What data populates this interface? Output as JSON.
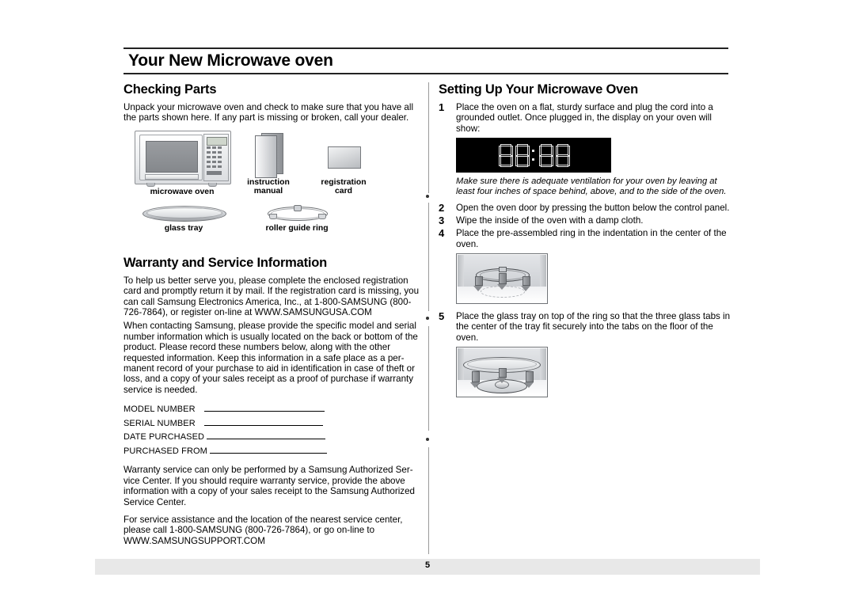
{
  "document": {
    "title": "Your New Microwave oven",
    "page_number": "5"
  },
  "left_column": {
    "checking_parts": {
      "heading": "Checking Parts",
      "intro": "Unpack your microwave oven and check to make sure that you have all the parts shown here. If any part is missing or broken, call your dealer.",
      "parts": [
        {
          "id": "microwave-oven",
          "label": "microwave oven"
        },
        {
          "id": "instruction-manual",
          "label": "instruction\nmanual"
        },
        {
          "id": "registration-card",
          "label": "registration\ncard"
        },
        {
          "id": "glass-tray",
          "label": "glass tray"
        },
        {
          "id": "roller-guide-ring",
          "label": "roller guide ring"
        }
      ]
    },
    "warranty": {
      "heading": "Warranty and Service Information",
      "paragraph1": "To help us better serve you, please complete the enclosed registration card and promptly return it by mail.  If the registration card is missing, you can call Samsung Electronics America, Inc., at 1-800-SAMSUNG (800-726-7864), or register on-line at WWW.SAMSUNGUSA.COM",
      "paragraph2": "When contacting Samsung, please provide the specific model and serial number information which is usually located on the back or bottom of the product.  Please record these numbers below, along with the other requested information.  Keep this information in a safe place as a per-manent record of your purchase to aid in identification in case of theft or loss, and a copy of your sales receipt as a proof of purchase if warranty service is needed.",
      "fields": [
        {
          "label": "MODEL NUMBER",
          "value": "",
          "line_width": 152,
          "gap": 8
        },
        {
          "label": "SERIAL NUMBER",
          "value": "",
          "line_width": 150,
          "gap": 8
        },
        {
          "label": "DATE PURCHASED",
          "value": "",
          "line_width": 150,
          "gap": 0
        },
        {
          "label": "PURCHASED FROM",
          "value": "",
          "line_width": 148,
          "gap": 0
        }
      ],
      "paragraph3": "Warranty service can only be performed by a Samsung Authorized Ser-vice Center.  If you should require warranty service, provide the above information with a copy of your sales receipt to the Samsung Authorized Service Center.",
      "paragraph4": "For service assistance and the location of the nearest service center, please call 1-800-SAMSUNG (800-726-7864), or go on-line to WWW.SAMSUNGSUPPORT.COM"
    }
  },
  "right_column": {
    "heading": "Setting Up Your Microwave Oven",
    "steps": [
      {
        "num": "1",
        "text": "Place the oven on a flat, sturdy surface and plug the cord into a grounded outlet.  Once plugged in, the display on your oven will show:"
      },
      {
        "num": "2",
        "text": "Open the oven door by pressing the button below the control panel."
      },
      {
        "num": "3",
        "text": "Wipe the inside of the oven with a damp cloth."
      },
      {
        "num": "4",
        "text": "Place the pre-assembled ring in the indentation in the center of the oven."
      },
      {
        "num": "5",
        "text": "Place the glass tray on top of the ring so that the three glass tabs in the center of the tray fit securely into the tabs on the floor of the oven."
      }
    ],
    "display": {
      "value": "88:88",
      "background": "#000000",
      "segment_color": "#e8e8e8"
    },
    "ventilation_note": "Make sure there is adequate ventilation for your oven by leaving at least four inches of space behind, above, and to the side of the oven."
  }
}
